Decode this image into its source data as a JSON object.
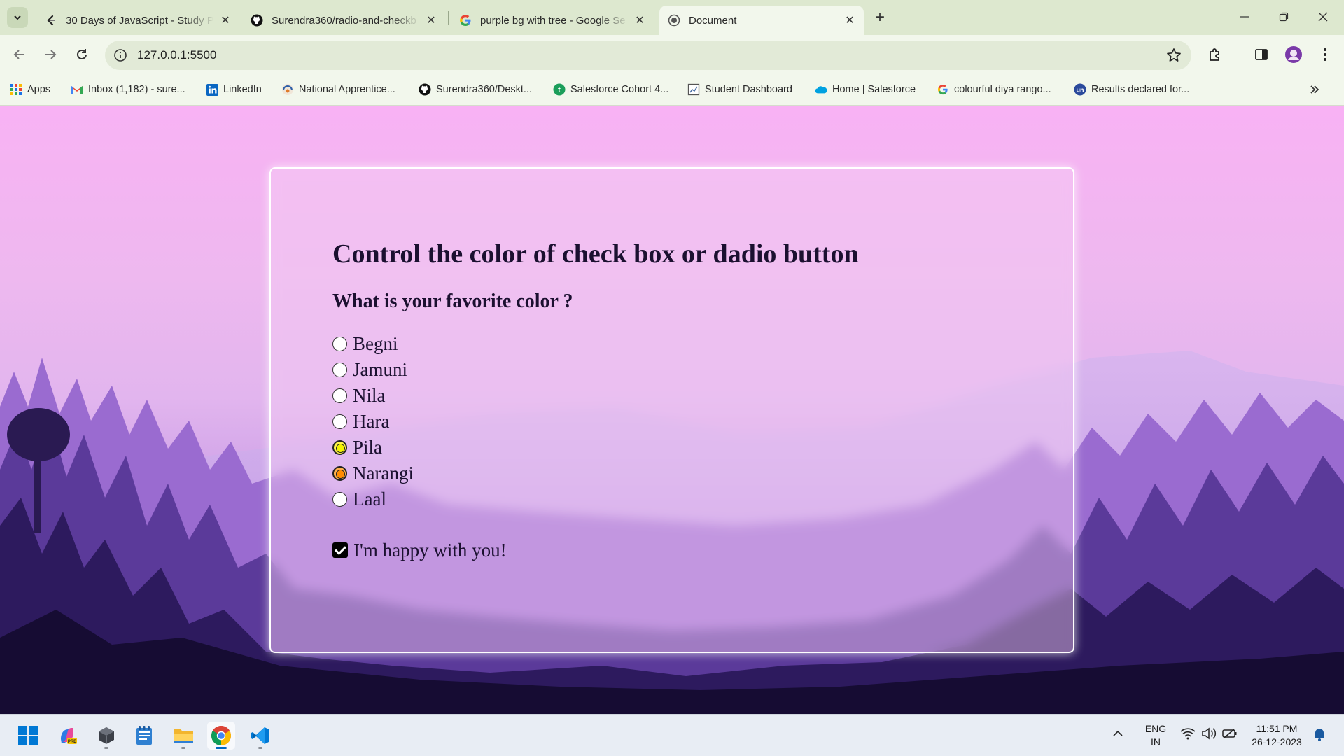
{
  "tabs": [
    {
      "title": "30 Days of JavaScript - Study Pl",
      "icon": "leetcode-icon"
    },
    {
      "title": "Surendra360/radio-and-checkb",
      "icon": "github-icon"
    },
    {
      "title": "purple bg with tree - Google Se",
      "icon": "google-icon"
    },
    {
      "title": "Document",
      "icon": "globe-icon",
      "active": true
    }
  ],
  "toolbar": {
    "url": "127.0.0.1:5500"
  },
  "bookmarks": [
    {
      "label": "Apps",
      "icon": "apps-grid-icon"
    },
    {
      "label": "Inbox (1,182) - sure...",
      "icon": "gmail-icon"
    },
    {
      "label": "LinkedIn",
      "icon": "linkedin-icon"
    },
    {
      "label": "National Apprentice...",
      "icon": "apprentice-icon"
    },
    {
      "label": "Surendra360/Deskt...",
      "icon": "github-icon"
    },
    {
      "label": "Salesforce Cohort 4...",
      "icon": "salesforce-cohort-icon"
    },
    {
      "label": "Student Dashboard",
      "icon": "dashboard-icon"
    },
    {
      "label": "Home | Salesforce",
      "icon": "salesforce-cloud-icon"
    },
    {
      "label": "colourful diya rango...",
      "icon": "google-icon"
    },
    {
      "label": "Results declared for...",
      "icon": "un-icon"
    }
  ],
  "page": {
    "heading": "Control the color of check box or dadio button",
    "question": "What is your favorite color ?",
    "options": [
      {
        "label": "Begni",
        "checked": false
      },
      {
        "label": "Jamuni",
        "checked": false
      },
      {
        "label": "Nila",
        "checked": false
      },
      {
        "label": "Hara",
        "checked": false
      },
      {
        "label": "Pila",
        "checked": true,
        "accent": "#f2f200"
      },
      {
        "label": "Narangi",
        "checked": true,
        "accent": "#ff8c00"
      },
      {
        "label": "Laal",
        "checked": false
      }
    ],
    "checkbox_label": "I'm happy with you!",
    "checkbox_checked": true
  },
  "taskbar": {
    "apps": [
      "windows-start-icon",
      "copilot-icon",
      "app-cube-icon",
      "notepad-icon",
      "file-explorer-icon",
      "chrome-icon",
      "vscode-icon"
    ],
    "lang_line1": "ENG",
    "lang_line2": "IN",
    "time": "11:51 PM",
    "date": "26-12-2023"
  },
  "colors": {
    "accent_yellow": "#f2f200",
    "accent_orange": "#ff8c00",
    "chrome_frame": "#dde8cf"
  }
}
